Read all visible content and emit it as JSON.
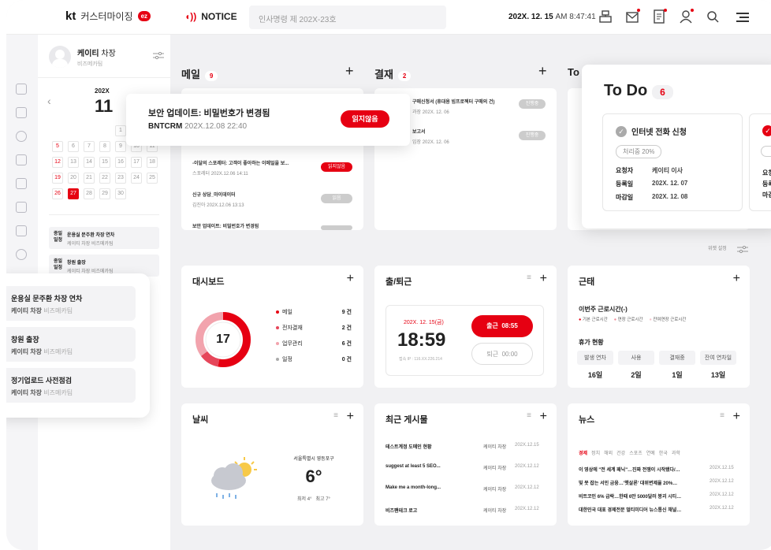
{
  "header": {
    "brand": "kt",
    "app_name": "커스터마이징",
    "badge": "ez",
    "notice_label": "NOTICE",
    "search_placeholder": "인사명령 제 202X-23호",
    "date": "202X. 12. 15",
    "time": "AM 8:47:41"
  },
  "profile": {
    "name": "케이티",
    "title": "차장",
    "team": "비즈메카팀"
  },
  "calendar": {
    "year": "202X",
    "month": "11",
    "rows": [
      [
        "",
        "",
        "",
        "",
        "1",
        "2",
        "3"
      ],
      [
        "5",
        "6",
        "7",
        "8",
        "9",
        "10",
        "11"
      ],
      [
        "12",
        "13",
        "14",
        "15",
        "16",
        "17",
        "18"
      ],
      [
        "19",
        "20",
        "21",
        "22",
        "23",
        "24",
        "25"
      ],
      [
        "26",
        "27",
        "28",
        "29",
        "30",
        "",
        ""
      ]
    ],
    "selected": "27"
  },
  "schedule": [
    {
      "tag1": "종일",
      "tag2": "일정",
      "title": "운용실 문주환 차장 연차",
      "who": "케이티 차장",
      "team": "비즈메카팀"
    },
    {
      "tag1": "종일",
      "tag2": "일정",
      "title": "창원 출장",
      "who": "케이티 차장",
      "team": "비즈메카팀"
    }
  ],
  "events": [
    {
      "title": "운용실 문주환 차장 연차",
      "who": "케이티 차장",
      "team": "비즈메카팀"
    },
    {
      "title": "창원 출장",
      "who": "케이티 차장",
      "team": "비즈메카팀"
    },
    {
      "title": "정기업로드 사전점검",
      "who": "케이티 차장",
      "team": "비즈메카팀"
    }
  ],
  "mail": {
    "title": "메일",
    "count": "9",
    "items": [
      {
        "title": "-이달의 스포레터: 고객이 좋아하는 이메일을 보...",
        "sender": "스포레터",
        "date": "202X.12.06 14:11",
        "btn": "읽지않음"
      },
      {
        "title": "신규 상담_마이데이터",
        "sender": "김진아",
        "date": "202X.12.06 13:13",
        "btn": "읽음"
      },
      {
        "title": "보안 업데이트: 비밀번호가 변경됨",
        "sender": "",
        "date": "",
        "btn": ""
      }
    ]
  },
  "toast": {
    "title": "보안 업데이트: 비밀번호가 변경됨",
    "sender": "BNTCRM",
    "date": "202X.12.08 22:40",
    "button": "읽지않음"
  },
  "approval": {
    "title": "결재",
    "count": "2",
    "items": [
      {
        "title": "구매신청서 (휴대용 빔프로젝터 구매의 건)",
        "sub": "과장",
        "date": "202X. 12. 06",
        "btn": "진행중"
      },
      {
        "title": "보고서",
        "sub": "입장",
        "date": "202X. 12. 06",
        "btn": "진행중"
      }
    ]
  },
  "todo": {
    "title": "To Do",
    "count": "6",
    "card": {
      "title": "인터넷 전화 신청",
      "status": "처리중 20%",
      "requester_label": "요청자",
      "requester": "케이티 이사",
      "reg_label": "등록일",
      "reg": "202X. 12. 07",
      "due_label": "마감일",
      "due": "202X. 12. 08"
    },
    "side_labels": [
      "요청",
      "등록",
      "마감"
    ]
  },
  "todo_col_label": "To",
  "widget_settings": "위젯 설정",
  "dashboard": {
    "title": "대시보드",
    "total": "17",
    "rows": [
      {
        "label": "메일",
        "value": "9 건",
        "color": "#e60012"
      },
      {
        "label": "전자결재",
        "value": "2 건",
        "color": "#e6465a"
      },
      {
        "label": "업무관리",
        "value": "6 건",
        "color": "#f2a3ad"
      },
      {
        "label": "일정",
        "value": "0 건",
        "color": "#aaaaaa"
      }
    ],
    "chart": {
      "values": [
        9,
        2,
        6,
        0
      ]
    }
  },
  "attendance": {
    "title": "출/퇴근",
    "date": "202X. 12. 15(금)",
    "clock": "18:59",
    "ip": "접속 IP : 116.XX.226.214",
    "in_label": "출근",
    "in_time": "08:55",
    "out_label": "퇴근",
    "out_time": "00:00"
  },
  "worktime": {
    "title": "근태",
    "week_label": "이번주 근로시간(-)",
    "legend": [
      "기본 근로시간",
      "연장 근로시간",
      "잔여연장 근로시간"
    ],
    "vac_label": "휴가 현황",
    "cols": [
      "발생 연차",
      "사용",
      "결재중",
      "잔여 연차일"
    ],
    "vals": [
      "16일",
      "2일",
      "1일",
      "13일"
    ]
  },
  "weather": {
    "title": "날씨",
    "location": "서울특별시 영등포구",
    "temp": "6°",
    "low": "최저 4°",
    "high": "최고 7°"
  },
  "board": {
    "title": "최근 게시물",
    "items": [
      {
        "title": "테스트계정 도메인 현황",
        "author": "케이티 차장",
        "date": "202X.12.15"
      },
      {
        "title": "suggest at least 5 SEO...",
        "author": "케이티 차장",
        "date": "202X.12.12"
      },
      {
        "title": "Make me a month-long...",
        "author": "케이티 차장",
        "date": "202X.12.12"
      },
      {
        "title": "비즈팬테크 로고",
        "author": "케이티 차장",
        "date": "202X.12.12"
      }
    ]
  },
  "news": {
    "title": "뉴스",
    "tabs": [
      "경제",
      "정치",
      "해외",
      "건강",
      "스포츠",
      "연예",
      "한국",
      "과학"
    ],
    "items": [
      {
        "title": "이 영상에 \"전 세계 패닉\"…진짜 전쟁이 시작됐다/…",
        "date": "202X.12.15"
      },
      {
        "title": "빛 못 잡는 서민 금융…'햇살론' 대위변제율 20%…",
        "date": "202X.12.12"
      },
      {
        "title": "비트코인 6% 급락…한때 6만 5000달러 붕괴 시티…",
        "date": "202X.12.12"
      },
      {
        "title": "대한민국 대표 경제전문 멀티미디어 뉴스통신 채널…",
        "date": "202X.12.12"
      }
    ]
  }
}
